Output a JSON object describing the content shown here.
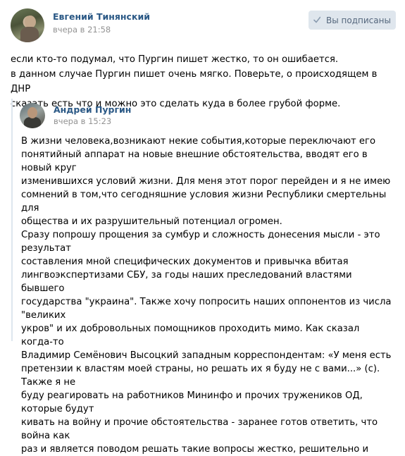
{
  "post": {
    "author": "Евгений Тинянский",
    "time": "вчера в 21:58",
    "subscribe_label": "Вы подписаны",
    "text_lines": [
      "если кто-то подумал, что Пургин пишет жестко, то он ошибается.",
      "в данном случае Пургин пишет очень мягко. Поверьте, о происходящем в ДНР",
      "сказать есть что и можно это сделать куда в более грубой форме."
    ]
  },
  "repost": {
    "author": "Андрей Пургин",
    "time": "вчера в 15:23",
    "text_lines": [
      "В жизни человека,возникают некие события,которые переключают его",
      "понятийный аппарат на новые внешние обстоятельства, вводят его в новый круг",
      "изменившихся условий жизни. Для меня этот порог перейден и я не имею",
      "сомнений в том,что сегодняшние условия жизни Республики смертельны для",
      "общества и их разрушительный потенциал огромен.",
      "Сразу попрошу прощения за сумбур и сложность донесения мысли - это результат",
      "составления мной специфических документов и привычка вбитая",
      "лингвоэкспертизами СБУ, за годы наших преследований властями бывшего",
      "государства \"украина\". Также хочу попросить наших оппонентов из числа \"великих",
      "укров\" и их добровольных помощников проходить мимо. Как сказал когда-то",
      "Владимир Семёнович Высоцкий западным корреспондентам: «У меня есть",
      "претензии к властям моей страны, но решать их я буду не с вами...» (с). Также я не",
      "буду реагировать на работников Мининфо и прочих тружеников ОД, которые будут",
      "кивать на войну и прочие обстоятельства - заранее готов ответить, что война как",
      "раз и является поводом решать такие вопросы жестко, решительно и"
    ]
  },
  "icons": {
    "check": "check-icon"
  },
  "colors": {
    "link": "#2a5885",
    "muted": "#939393",
    "button_bg": "#dfe6ed",
    "button_text": "#55677d",
    "repost_border": "#dee6ee"
  }
}
